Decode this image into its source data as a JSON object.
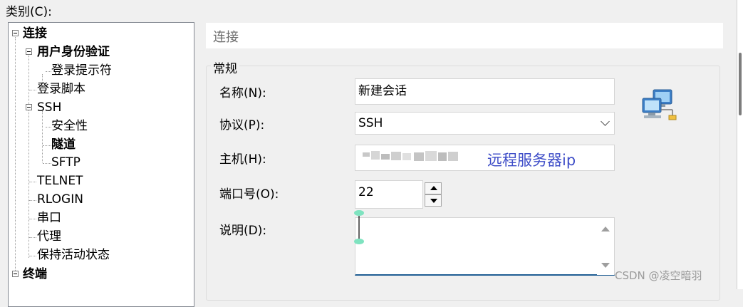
{
  "dialog": {
    "category_label": "类别(C):"
  },
  "tree": {
    "items": [
      {
        "label": "连接",
        "bold": true
      },
      {
        "label": "用户身份验证",
        "bold": true
      },
      {
        "label": "登录提示符",
        "bold": false
      },
      {
        "label": "登录脚本",
        "bold": false
      },
      {
        "label": "SSH",
        "bold": false
      },
      {
        "label": "安全性",
        "bold": false
      },
      {
        "label": "隧道",
        "bold": true
      },
      {
        "label": "SFTP",
        "bold": false
      },
      {
        "label": "TELNET",
        "bold": false
      },
      {
        "label": "RLOGIN",
        "bold": false
      },
      {
        "label": "串口",
        "bold": false
      },
      {
        "label": "代理",
        "bold": false
      },
      {
        "label": "保持活动状态",
        "bold": false
      },
      {
        "label": "终端",
        "bold": true
      }
    ]
  },
  "panel": {
    "title": "连接",
    "group_title": "常规",
    "fields": {
      "name_label": "名称(N):",
      "name_value": "新建会话",
      "protocol_label": "协议(P):",
      "protocol_value": "SSH",
      "host_label": "主机(H):",
      "port_label": "端口号(O):",
      "port_value": "22",
      "description_label": "说明(D):"
    }
  },
  "annotation": "远程服务器ip",
  "watermark": "CSDN @凌空暗羽",
  "icons": {
    "network": "network-computers-icon",
    "protocol_dropdown": "chevron-down-icon"
  },
  "colors": {
    "annotation": "#3f4ec8",
    "textarea_focus": "#1f5e93"
  }
}
